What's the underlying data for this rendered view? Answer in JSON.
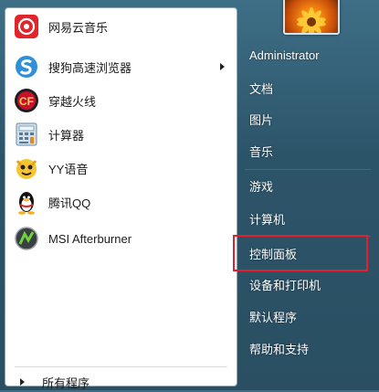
{
  "programs": [
    {
      "label": "网易云音乐",
      "icon": "netease-music-icon",
      "submenu": false
    },
    {
      "label": "搜狗高速浏览器",
      "icon": "sogou-browser-icon",
      "submenu": true
    },
    {
      "label": "穿越火线",
      "icon": "crossfire-icon",
      "submenu": false
    },
    {
      "label": "计算器",
      "icon": "calculator-icon",
      "submenu": false
    },
    {
      "label": "YY语音",
      "icon": "yy-voice-icon",
      "submenu": false
    },
    {
      "label": "腾讯QQ",
      "icon": "qq-penguin-icon",
      "submenu": false
    },
    {
      "label": "MSI Afterburner",
      "icon": "msi-afterburner-icon",
      "submenu": false
    }
  ],
  "all_programs_label": "所有程序",
  "right_items": [
    {
      "label": "Administrator"
    },
    {
      "label": "文档"
    },
    {
      "label": "图片"
    },
    {
      "label": "音乐"
    },
    {
      "label": "游戏"
    },
    {
      "label": "计算机"
    },
    {
      "label": "控制面板"
    },
    {
      "label": "设备和打印机"
    },
    {
      "label": "默认程序"
    },
    {
      "label": "帮助和支持"
    }
  ],
  "highlighted_item": "控制面板",
  "colors": {
    "highlight_border": "#e2212d",
    "panel_bg": "#2c5469"
  }
}
